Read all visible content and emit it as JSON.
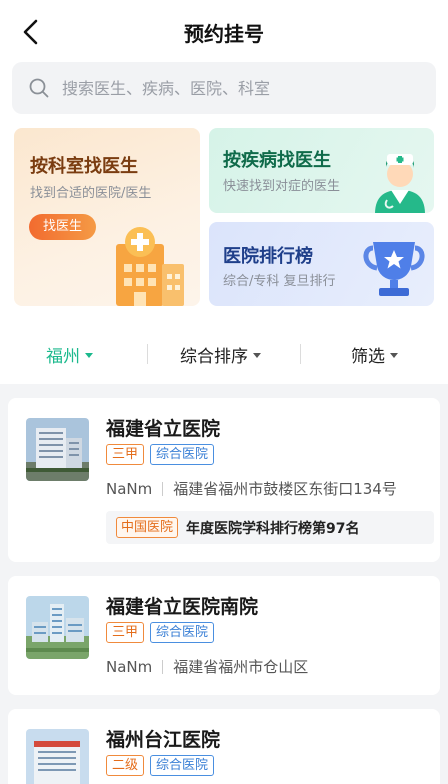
{
  "header": {
    "title": "预约挂号"
  },
  "search": {
    "placeholder": "搜索医生、疾病、医院、科室"
  },
  "entries": {
    "by_department": {
      "title": "按科室找医生",
      "subtitle": "找到合适的医院/医生",
      "button": "找医生"
    },
    "by_disease": {
      "title": "按疾病找医生",
      "subtitle": "快速找到对症的医生"
    },
    "ranking": {
      "title": "医院排行榜",
      "subtitle": "综合/专科 复旦排行"
    }
  },
  "filters": [
    {
      "label": "福州",
      "active": true
    },
    {
      "label": "综合排序",
      "active": false
    },
    {
      "label": "筛选",
      "active": false
    }
  ],
  "hospitals": [
    {
      "name": "福建省立医院",
      "level": "三甲",
      "type": "综合医院",
      "distance": "NaNm",
      "address": "福建省福州市鼓楼区东街口134号",
      "rank_tag": "中国医院",
      "rank_text": "年度医院学科排行榜第97名"
    },
    {
      "name": "福建省立医院南院",
      "level": "三甲",
      "type": "综合医院",
      "distance": "NaNm",
      "address": "福建省福州市仓山区"
    },
    {
      "name": "福州台江医院",
      "level": "二级",
      "type": "综合医院"
    }
  ],
  "colors": {
    "accent": "#1bb98d",
    "level_tag": "#e46d1b",
    "type_tag": "#3a7fd5"
  }
}
